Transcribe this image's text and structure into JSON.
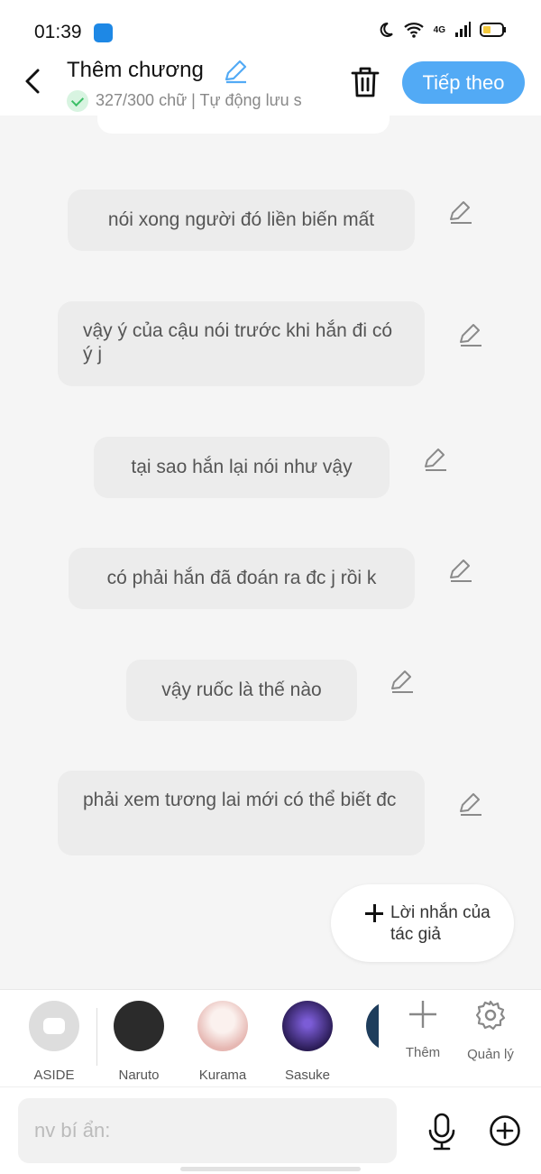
{
  "status_bar": {
    "time": "01:39",
    "network": "4G"
  },
  "header": {
    "title": "Thêm chương",
    "subtitle": "327/300 chữ | Tự động lưu s",
    "next_label": "Tiếp theo"
  },
  "messages": [
    {
      "text": "nói xong người đó liền biến mất"
    },
    {
      "text": "vậy ý của cậu nói trước khi hắn đi có ý j"
    },
    {
      "text": "tại sao hắn lại nói như vậy"
    },
    {
      "text": "có phải hắn đã đoán ra đc j rồi k"
    },
    {
      "text": "vậy ruốc là thế nào"
    },
    {
      "text": "phải xem tương lai mới có thể biết đc"
    }
  ],
  "author_note_button": {
    "label": "Lời nhắn của tác giả"
  },
  "characters": [
    {
      "name": "ASIDE",
      "avatar_color": "#dddddd"
    },
    {
      "name": "Naruto",
      "avatar_color": "#2b2b2b"
    },
    {
      "name": "Kurama",
      "avatar_color": "#f2d4d0"
    },
    {
      "name": "Sasuke",
      "avatar_color": "#3a2a6b"
    }
  ],
  "tools": {
    "add_label": "Thêm",
    "manage_label": "Quản lý"
  },
  "input": {
    "placeholder": "nv bí ẩn:",
    "value": ""
  },
  "colors": {
    "accent": "#52aaf5",
    "bubble": "#ececec",
    "background": "#f5f5f5",
    "saved_check": "#3cbf67"
  }
}
